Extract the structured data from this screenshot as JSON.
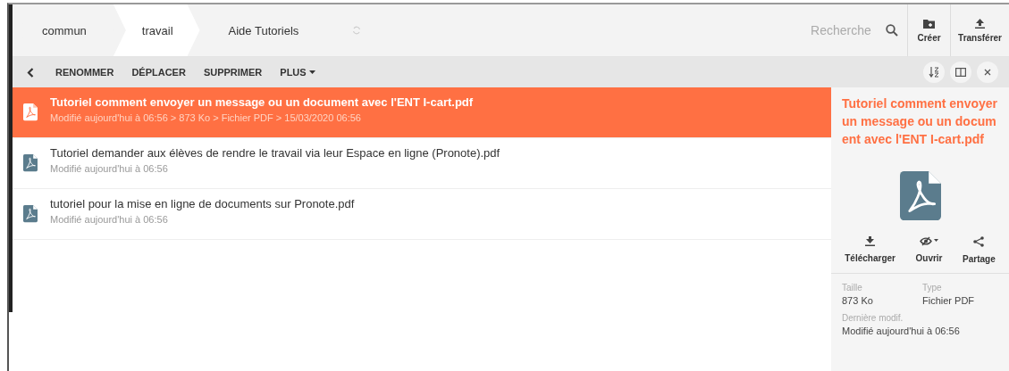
{
  "breadcrumb": [
    {
      "label": "commun",
      "selected": false
    },
    {
      "label": "travail",
      "selected": true
    },
    {
      "label": "Aide Tutoriels",
      "selected": false
    }
  ],
  "search": {
    "placeholder": "Recherche"
  },
  "top_actions": [
    {
      "label": "Créer",
      "kind": "create"
    },
    {
      "label": "Transférer",
      "kind": "upload"
    }
  ],
  "toolbar": {
    "actions": [
      "RENOMMER",
      "DÉPLACER",
      "SUPPRIMER",
      "PLUS"
    ]
  },
  "files": [
    {
      "name": "Tutoriel comment envoyer un message ou un document avec l'ENT I-cart.pdf",
      "meta": "Modifié aujourd'hui à 06:56 > 873 Ko > Fichier PDF > 15/03/2020 06:56",
      "selected": true
    },
    {
      "name": "Tutoriel demander aux élèves de rendre le travail via leur Espace en ligne (Pronote).pdf",
      "meta": "Modifié aujourd'hui à 06:56",
      "selected": false
    },
    {
      "name": "tutoriel pour la mise en ligne de documents sur Pronote.pdf",
      "meta": "Modifié aujourd'hui à 06:56",
      "selected": false
    }
  ],
  "details": {
    "title": "Tutoriel comment envoyer un message ou un document avec l'ENT I-cart.pdf",
    "actions": [
      {
        "label": "Télécharger",
        "kind": "download"
      },
      {
        "label": "Ouvrir",
        "kind": "open"
      },
      {
        "label": "Partage",
        "kind": "share"
      }
    ],
    "properties": [
      {
        "label": "Taille",
        "value": "873 Ko"
      },
      {
        "label": "Type",
        "value": "Fichier PDF"
      },
      {
        "label": "Dernière modif.",
        "value": "Modifié aujourd'hui à 06:56"
      }
    ]
  }
}
